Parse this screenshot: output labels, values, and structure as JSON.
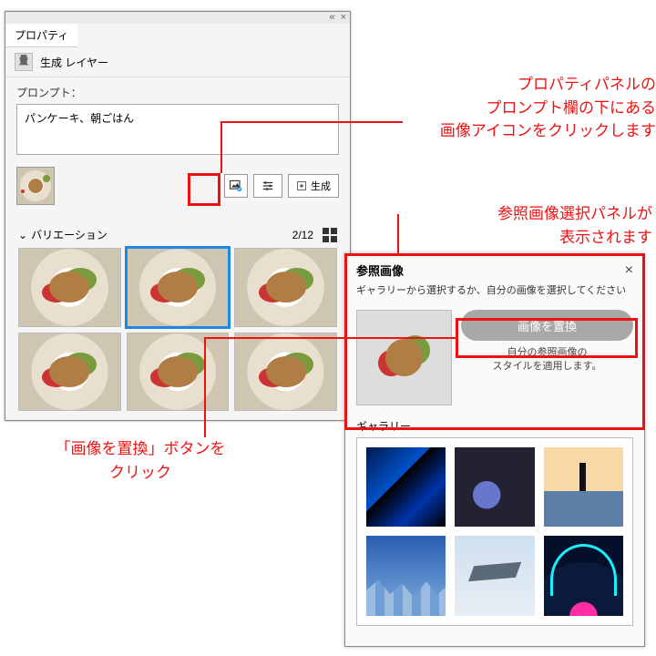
{
  "prop_panel": {
    "tab_label": "プロパティ",
    "gen_layer_label": "生成 レイヤー",
    "prompt_label": "プロンプト：",
    "prompt_value": "パンケーキ、朝ごはん",
    "generate_label": "生成",
    "variation_label": "バリエーション",
    "variation_count": "2/12"
  },
  "ref_panel": {
    "title": "参照画像",
    "subtitle": "ギャラリーから選択するか、自分の画像を選択してください",
    "replace_label": "画像を置換",
    "desc_line1": "自分の参照画像の",
    "desc_line2": "スタイルを適用します。",
    "gallery_label": "ギャラリー"
  },
  "annotations": {
    "a1": "プロパティパネルの\nプロンプト欄の下にある\n画像アイコンをクリックします",
    "a2": "参照画像選択パネルが\n表示されます",
    "a3": "「画像を置換」ボタンを\nクリック"
  }
}
